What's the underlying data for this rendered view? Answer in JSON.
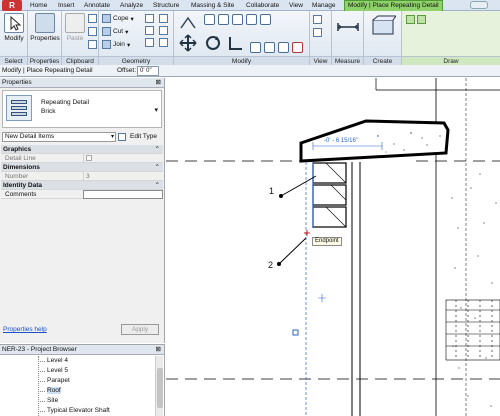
{
  "ribbon": {
    "app_button": "R",
    "tabs": [
      "Home",
      "Insert",
      "Annotate",
      "Analyze",
      "Structure",
      "Massing & Site",
      "Collaborate",
      "View",
      "Manage",
      "Modify | Place Repeating Detail"
    ],
    "active_tab": "Modify | Place Repeating Detail",
    "panels": {
      "select": {
        "button": "Modify",
        "title": "Select"
      },
      "properties": {
        "button": "Properties",
        "title": "Properties"
      },
      "clipboard": {
        "button": "Paste",
        "title": "Clipboard"
      },
      "geometry": {
        "items": [
          "Cope",
          "Cut",
          "Join"
        ],
        "title": "Geometry"
      },
      "modify": {
        "title": "Modify"
      },
      "view": {
        "title": "View"
      },
      "measure": {
        "title": "Measure"
      },
      "create": {
        "title": "Create"
      },
      "draw": {
        "title": "Draw"
      }
    }
  },
  "options_bar": {
    "context": "Modify | Place Repeating Detail",
    "offset_label": "Offset:",
    "offset_value": "0'  0\""
  },
  "properties": {
    "title": "Properties",
    "type_family": "Repeating Detail",
    "type_name": "Brick",
    "filter": "New Detail Items",
    "edit_type": "Edit Type",
    "groups": [
      {
        "name": "Graphics",
        "rows": [
          {
            "key": "Detail Line",
            "value": ""
          }
        ]
      },
      {
        "name": "Dimensions",
        "rows": [
          {
            "key": "Number",
            "value": "3"
          }
        ]
      },
      {
        "name": "Identity Data",
        "rows": [
          {
            "key": "Comments",
            "value": ""
          }
        ]
      }
    ],
    "help_link": "Properties help",
    "apply": "Apply"
  },
  "browser": {
    "title": "NER-23 - Project Browser",
    "items": [
      "Level 4",
      "Level 5",
      "Parapet",
      "Roof",
      "Site",
      "Typical Elevator Shaft"
    ],
    "selected": "Roof"
  },
  "canvas": {
    "callout_1": "1",
    "callout_2": "2",
    "dimension": "-0' - 6 15/16\"",
    "snap_tooltip": "Endpoint"
  }
}
